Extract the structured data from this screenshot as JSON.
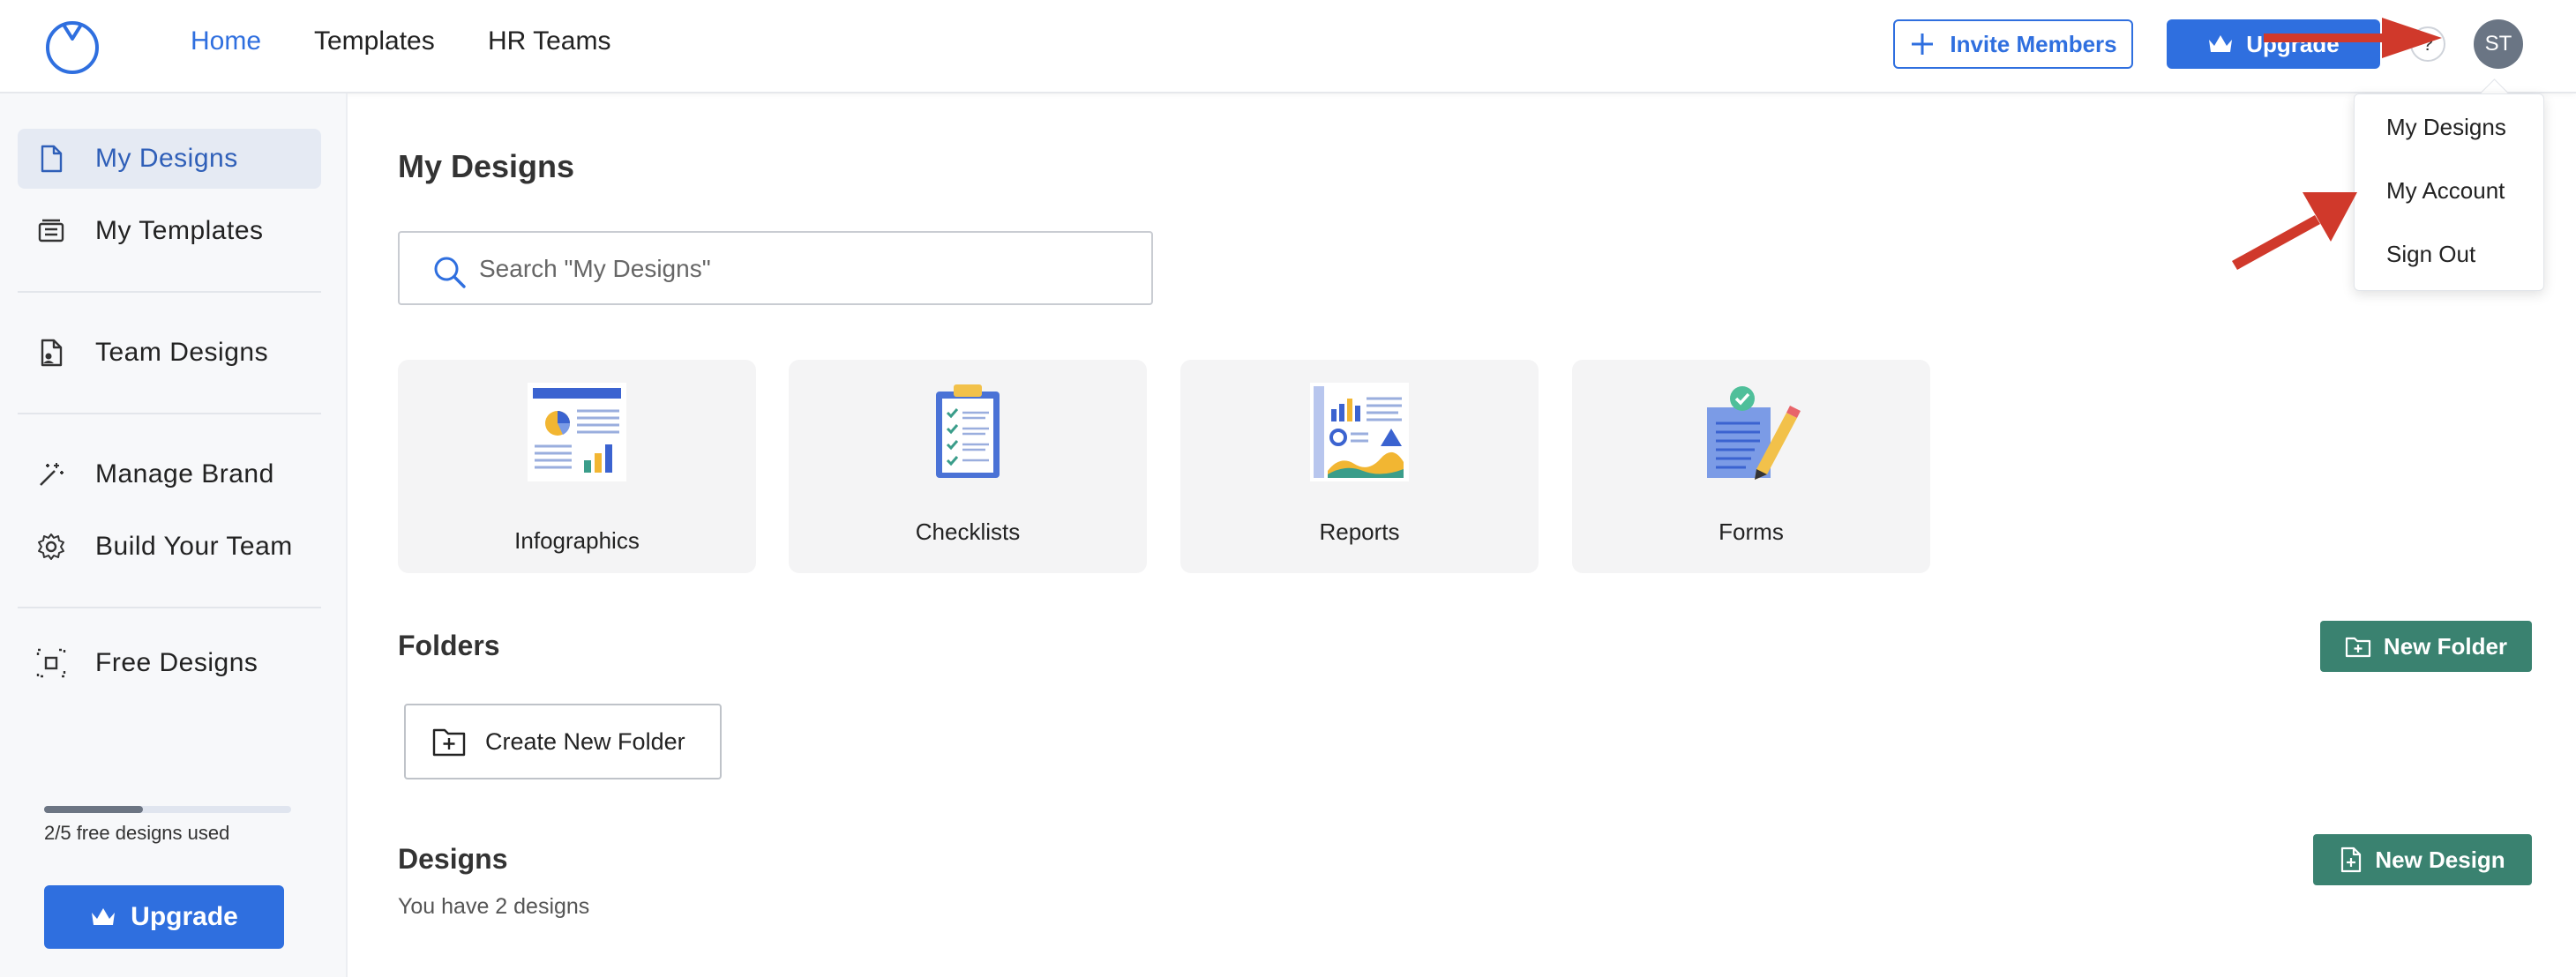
{
  "nav": {
    "home": "Home",
    "templates": "Templates",
    "hr_teams": "HR Teams",
    "invite": "Invite Members",
    "upgrade": "Upgrade",
    "help": "?",
    "avatar_initials": "ST"
  },
  "dropdown": {
    "items": [
      "My Designs",
      "My Account",
      "Sign Out"
    ]
  },
  "sidebar": {
    "items": [
      {
        "label": "My Designs",
        "icon": "document-icon"
      },
      {
        "label": "My Templates",
        "icon": "templates-icon"
      },
      {
        "label": "Team Designs",
        "icon": "team-document-icon"
      },
      {
        "label": "Manage Brand",
        "icon": "magic-wand-icon"
      },
      {
        "label": "Build Your Team",
        "icon": "gear-icon"
      },
      {
        "label": "Free Designs",
        "icon": "focus-icon"
      }
    ],
    "progress_text": "2/5 free designs used",
    "progress_value": 0.4,
    "upgrade_label": "Upgrade"
  },
  "main": {
    "title": "My Designs",
    "search_placeholder": "Search \"My Designs\"",
    "cards": [
      {
        "label": "Infographics"
      },
      {
        "label": "Checklists"
      },
      {
        "label": "Reports"
      },
      {
        "label": "Forms"
      }
    ],
    "folders_title": "Folders",
    "new_folder_label": "New Folder",
    "create_folder_label": "Create New Folder",
    "designs_title": "Designs",
    "designs_subtitle": "You have 2 designs",
    "new_design_label": "New Design"
  },
  "colors": {
    "primary": "#2f6fdf",
    "green": "#3a8270",
    "annotation_arrow": "#d0392b"
  }
}
